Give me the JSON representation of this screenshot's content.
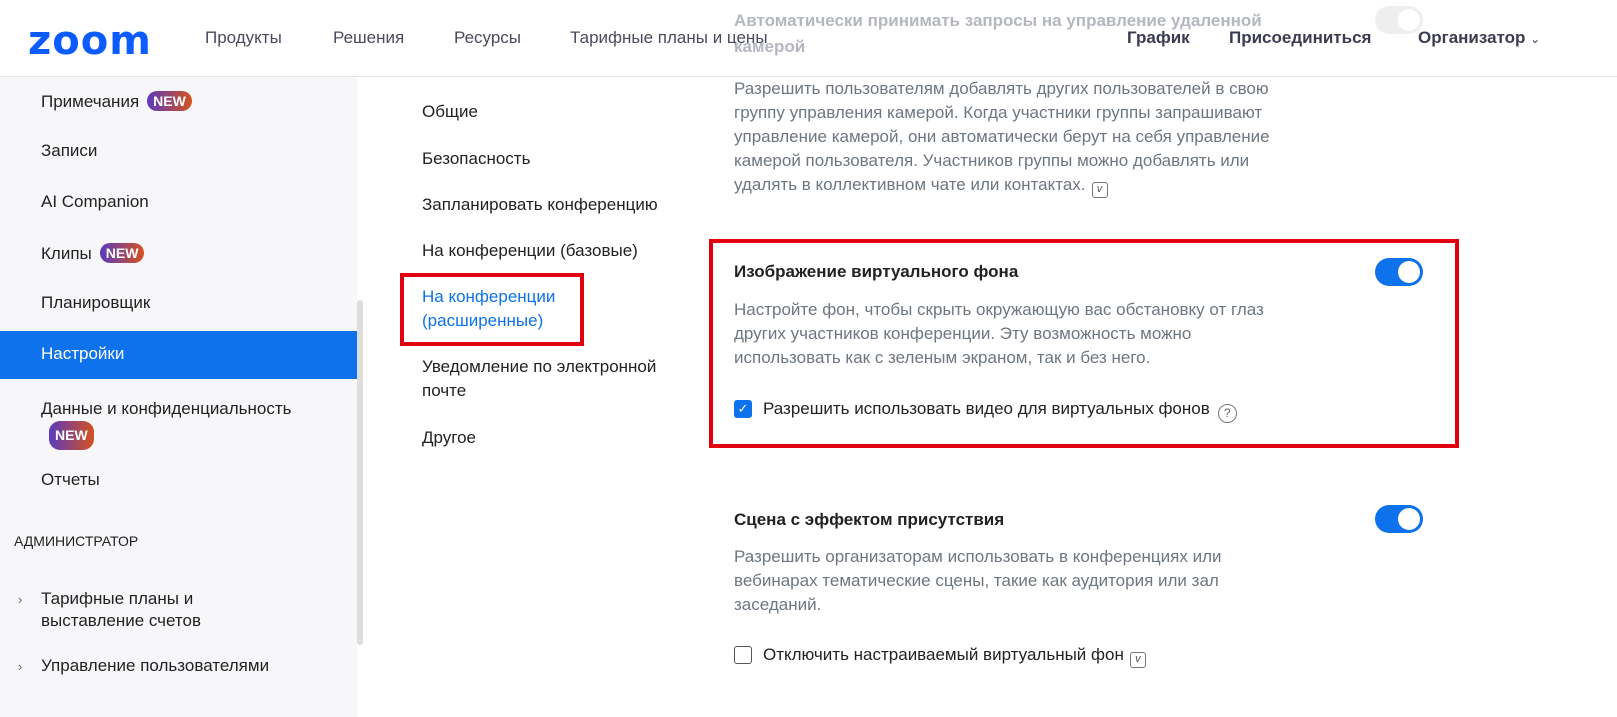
{
  "header": {
    "logo": "zoom",
    "nav": [
      "Продукты",
      "Решения",
      "Ресурсы",
      "Тарифные планы и цены"
    ],
    "right": [
      "График",
      "Присоединиться",
      "Организатор"
    ]
  },
  "sidebar": {
    "items": [
      {
        "label": "Примечания",
        "badge": "NEW"
      },
      {
        "label": "Записи"
      },
      {
        "label": "AI Companion"
      },
      {
        "label": "Клипы",
        "badge": "NEW"
      },
      {
        "label": "Планировщик"
      },
      {
        "label": "Настройки",
        "selected": true
      },
      {
        "label": "Данные и конфиденциальность",
        "badge": "NEW"
      },
      {
        "label": "Отчеты"
      }
    ],
    "admin_heading": "АДМИНИСТРАТОР",
    "admin_items": [
      {
        "label_1": "Тарифные планы и",
        "label_2": "выставление счетов"
      },
      {
        "label": "Управление пользователями"
      }
    ]
  },
  "settings_nav": {
    "items": [
      "Общие",
      "Безопасность",
      "Запланировать конференцию",
      "На конференции (базовые)"
    ],
    "active_1": "На конференции",
    "active_2": "(расширенные)",
    "email_1": "Уведомление по электронной",
    "email_2": "почте",
    "other": "Другое"
  },
  "settings": {
    "camera": {
      "title_1": "Автоматически принимать запросы на управление удаленной",
      "title_2": "камерой",
      "desc": [
        "Разрешить пользователям добавлять других пользователей в свою",
        "группу управления камерой. Когда участники группы запрашивают",
        "управление камерой, они автоматически берут на себя управление",
        "камерой пользователя. Участников группы можно добавлять или",
        "удалять в коллективном чате или контактах."
      ]
    },
    "virtual_bg": {
      "title": "Изображение виртуального фона",
      "enabled": true,
      "desc": [
        "Настройте фон, чтобы скрыть окружающую вас обстановку от глаз",
        "других участников конференции. Эту возможность можно",
        "использовать как с зеленым экраном, так и без него."
      ],
      "checkbox_label": "Разрешить использовать видео для виртуальных фонов",
      "checkbox_checked": true
    },
    "immersive": {
      "title": "Сцена с эффектом присутствия",
      "enabled": true,
      "desc": [
        "Разрешить организаторам использовать в конференциях или",
        "вебинарах тематические сцены, такие как аудитория или зал",
        "заседаний."
      ],
      "checkbox_label": "Отключить настраиваемый виртуальный фон",
      "checkbox_checked": false
    }
  },
  "colors": {
    "accent": "#0e72ed",
    "highlight": "#e0000f",
    "logo": "#0b5cff"
  }
}
